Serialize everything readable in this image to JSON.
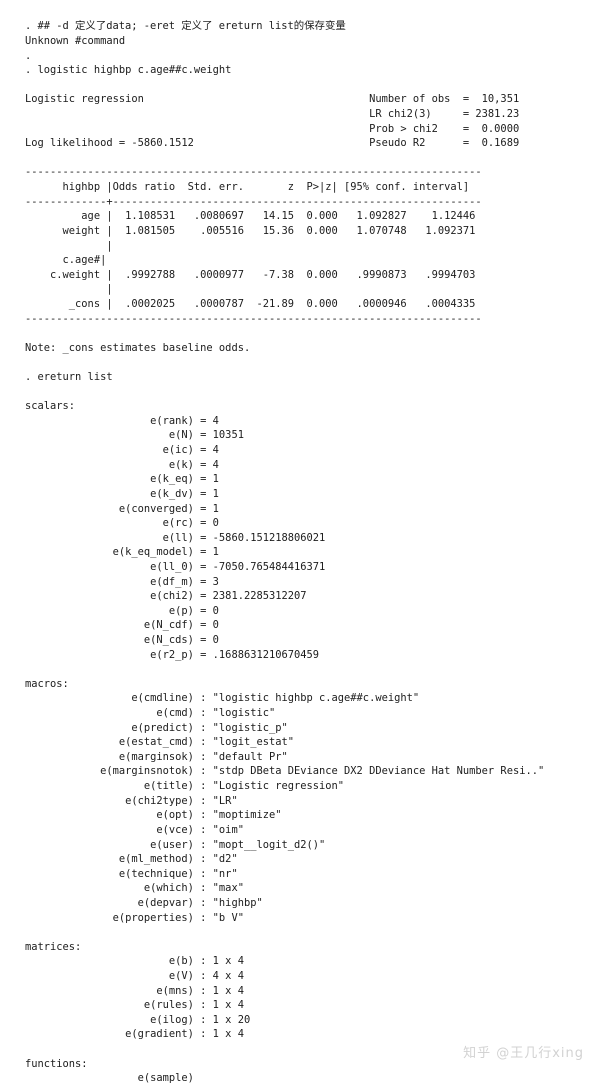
{
  "terminal": {
    "background_color": "#ffffff",
    "text_color": "#1c1c1c",
    "command_prompt": ".",
    "comment_line": ". ## -d 定义了data; -eret 定义了 ereturn list的保存变量",
    "error_line": "Unknown #command",
    "command_logistic": ". logistic highbp c.age##c.weight",
    "command_ereturn": ". ereturn list"
  },
  "regression": {
    "title": "Logistic regression",
    "log_likelihood_label": "Log likelihood",
    "log_likelihood_value": "-5860.1512",
    "stats": [
      {
        "label": "Number of obs",
        "value": "10,351"
      },
      {
        "label": "LR chi2(3)",
        "value": "2381.23"
      },
      {
        "label": "Prob > chi2",
        "value": "0.0000"
      },
      {
        "label": "Pseudo R2",
        "value": "0.1689"
      }
    ],
    "table": {
      "depvar_header": "highbp",
      "columns": [
        "Odds ratio",
        "Std. err.",
        "z",
        "P>|z|",
        "[95% conf. interval]"
      ],
      "rows": [
        {
          "name": "age",
          "odds": "1.108531",
          "se": ".0080697",
          "z": "14.15",
          "p": "0.000",
          "ci_lo": "1.092827",
          "ci_hi": "1.12446"
        },
        {
          "name": "weight",
          "odds": "1.081505",
          "se": ".005516",
          "z": "15.36",
          "p": "0.000",
          "ci_lo": "1.070748",
          "ci_hi": "1.092371"
        },
        {
          "name": "c.age#",
          "odds": "",
          "se": "",
          "z": "",
          "p": "",
          "ci_lo": "",
          "ci_hi": ""
        },
        {
          "name": "c.weight",
          "odds": ".9992788",
          "se": ".0000977",
          "z": "-7.38",
          "p": "0.000",
          "ci_lo": ".9990873",
          "ci_hi": ".9994703"
        },
        {
          "name": "_cons",
          "odds": ".0002025",
          "se": ".0000787",
          "z": "-21.89",
          "p": "0.000",
          "ci_lo": ".0000946",
          "ci_hi": ".0004335"
        }
      ],
      "note": "Note: _cons estimates baseline odds."
    }
  },
  "ereturn": {
    "scalars_header": "scalars:",
    "scalars": [
      {
        "name": "e(rank)",
        "value": "4"
      },
      {
        "name": "e(N)",
        "value": "10351"
      },
      {
        "name": "e(ic)",
        "value": "4"
      },
      {
        "name": "e(k)",
        "value": "4"
      },
      {
        "name": "e(k_eq)",
        "value": "1"
      },
      {
        "name": "e(k_dv)",
        "value": "1"
      },
      {
        "name": "e(converged)",
        "value": "1"
      },
      {
        "name": "e(rc)",
        "value": "0"
      },
      {
        "name": "e(ll)",
        "value": "-5860.151218806021"
      },
      {
        "name": "e(k_eq_model)",
        "value": "1"
      },
      {
        "name": "e(ll_0)",
        "value": "-7050.765484416371"
      },
      {
        "name": "e(df_m)",
        "value": "3"
      },
      {
        "name": "e(chi2)",
        "value": "2381.2285312207"
      },
      {
        "name": "e(p)",
        "value": "0"
      },
      {
        "name": "e(N_cdf)",
        "value": "0"
      },
      {
        "name": "e(N_cds)",
        "value": "0"
      },
      {
        "name": "e(r2_p)",
        "value": ".1688631210670459"
      }
    ],
    "macros_header": "macros:",
    "macros": [
      {
        "name": "e(cmdline)",
        "value": "\"logistic highbp c.age##c.weight\""
      },
      {
        "name": "e(cmd)",
        "value": "\"logistic\""
      },
      {
        "name": "e(predict)",
        "value": "\"logistic_p\""
      },
      {
        "name": "e(estat_cmd)",
        "value": "\"logit_estat\""
      },
      {
        "name": "e(marginsok)",
        "value": "\"default Pr\""
      },
      {
        "name": "e(marginsnotok)",
        "value": "\"stdp DBeta DEviance DX2 DDeviance Hat Number Resi..\""
      },
      {
        "name": "e(title)",
        "value": "\"Logistic regression\""
      },
      {
        "name": "e(chi2type)",
        "value": "\"LR\""
      },
      {
        "name": "e(opt)",
        "value": "\"moptimize\""
      },
      {
        "name": "e(vce)",
        "value": "\"oim\""
      },
      {
        "name": "e(user)",
        "value": "\"mopt__logit_d2()\""
      },
      {
        "name": "e(ml_method)",
        "value": "\"d2\""
      },
      {
        "name": "e(technique)",
        "value": "\"nr\""
      },
      {
        "name": "e(which)",
        "value": "\"max\""
      },
      {
        "name": "e(depvar)",
        "value": "\"highbp\""
      },
      {
        "name": "e(properties)",
        "value": "\"b V\""
      }
    ],
    "matrices_header": "matrices:",
    "matrices": [
      {
        "name": "e(b)",
        "value": "1 x 4"
      },
      {
        "name": "e(V)",
        "value": "4 x 4"
      },
      {
        "name": "e(mns)",
        "value": "1 x 4"
      },
      {
        "name": "e(rules)",
        "value": "1 x 4"
      },
      {
        "name": "e(ilog)",
        "value": "1 x 20"
      },
      {
        "name": "e(gradient)",
        "value": "1 x 4"
      }
    ],
    "functions_header": "functions:",
    "functions": [
      {
        "name": "e(sample)",
        "value": ""
      }
    ]
  },
  "watermark": {
    "text": "知乎 @王几行xing"
  }
}
